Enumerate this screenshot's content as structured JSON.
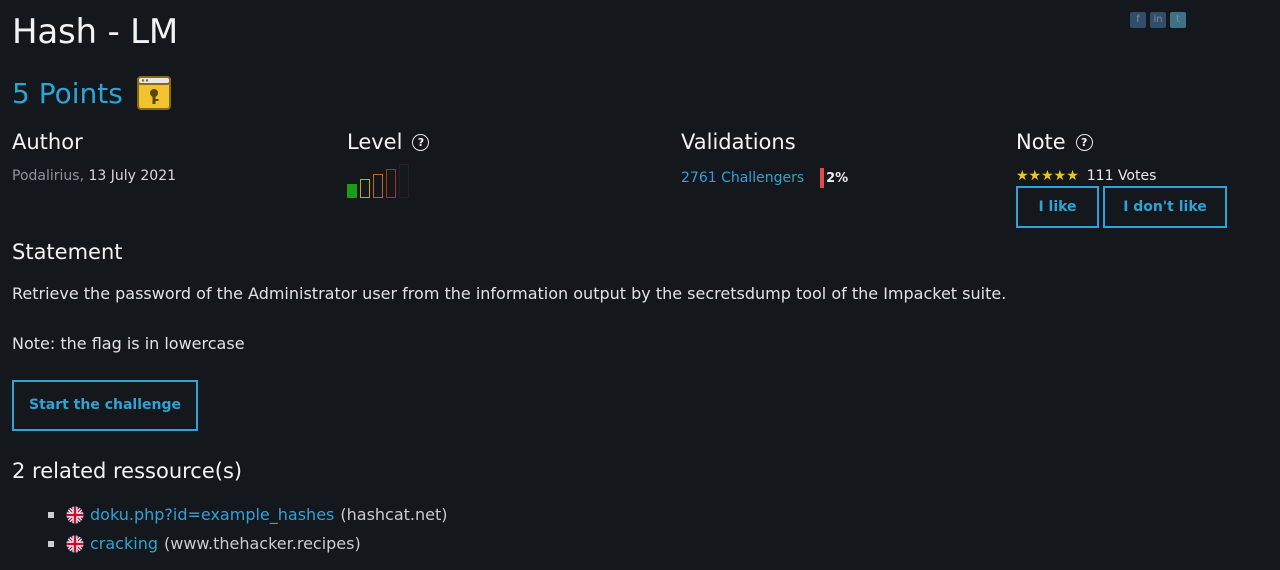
{
  "social": {
    "facebook": "f",
    "linkedin": "in",
    "twitter": "t"
  },
  "header": {
    "title": "Hash - LM",
    "points": "5 Points",
    "points_icon": "key-window-icon"
  },
  "author": {
    "heading": "Author",
    "name": "Podalirius",
    "separator": ",",
    "date": "13 July 2021"
  },
  "level": {
    "heading": "Level",
    "current": 1,
    "max": 5,
    "colors": [
      "#1a9b1a",
      "#c9a227",
      "#b86a1e",
      "#a8321e",
      "#222222"
    ]
  },
  "validations": {
    "heading": "Validations",
    "challengers": "2761 Challengers",
    "percent": "2%"
  },
  "note": {
    "heading": "Note",
    "stars": "★★★★★",
    "votes": "111 Votes",
    "like_label": "I like",
    "dislike_label": "I don't like"
  },
  "statement": {
    "heading": "Statement",
    "text": "Retrieve the password of the Administrator user from the information output by the secretsdump tool of the Impacket suite.",
    "note": "Note: the flag is in lowercase",
    "start_label": "Start the challenge"
  },
  "related": {
    "heading": "2 related ressource(s)",
    "items": [
      {
        "link": "doku.php?id=example_hashes",
        "domain": "(hashcat.net)"
      },
      {
        "link": "cracking",
        "domain": "(www.thehacker.recipes)"
      }
    ]
  },
  "colors": {
    "accent": "#2fa3d6",
    "background": "#14171c",
    "star": "#f0c419",
    "percent_bar": "#e04b4b"
  }
}
